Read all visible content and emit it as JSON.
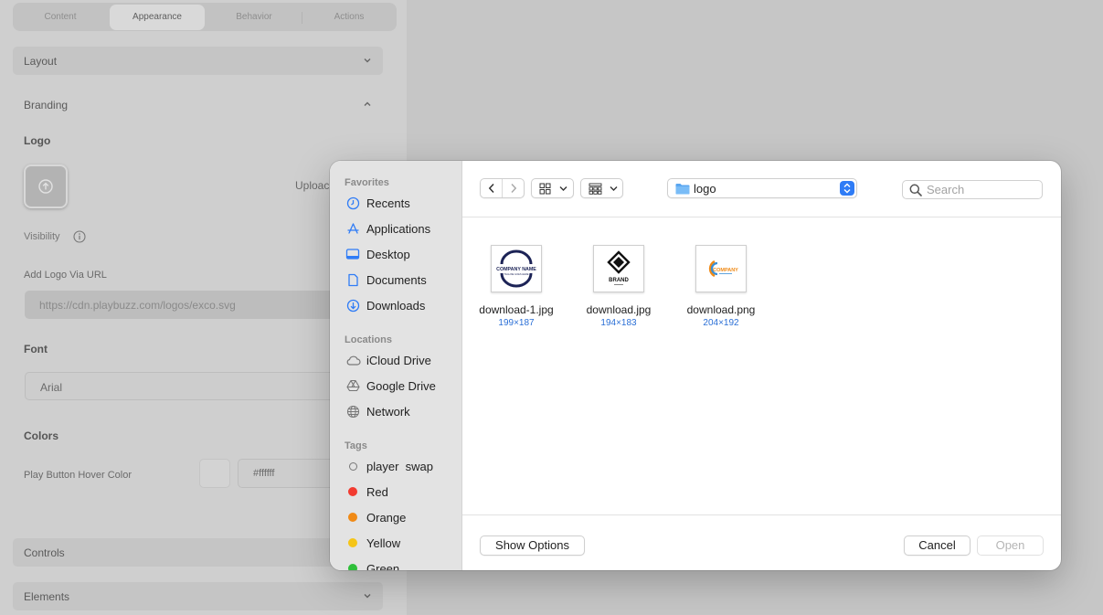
{
  "settings": {
    "tabs": [
      "Content",
      "Appearance",
      "Behavior",
      "Actions"
    ],
    "sections": {
      "layout": "Layout",
      "branding": "Branding",
      "controls": "Controls",
      "elements": "Elements"
    },
    "logo_label": "Logo",
    "upload_label": "Uploac",
    "visibility_label": "Visibility",
    "url_label": "Add Logo Via URL",
    "url_placeholder": "https://cdn.playbuzz.com/logos/exco.svg",
    "font_label": "Font",
    "font_value": "Arial",
    "colors_label": "Colors",
    "hover_color_label": "Play Button Hover Color",
    "hover_color_value": "#ffffff"
  },
  "dialog": {
    "sidebar": {
      "favorites_heading": "Favorites",
      "favorites": [
        {
          "label": "Recents",
          "icon": "clock-icon"
        },
        {
          "label": "Applications",
          "icon": "applications-icon"
        },
        {
          "label": "Desktop",
          "icon": "desktop-icon"
        },
        {
          "label": "Documents",
          "icon": "document-icon"
        },
        {
          "label": "Downloads",
          "icon": "download-icon"
        }
      ],
      "locations_heading": "Locations",
      "locations": [
        {
          "label": "iCloud Drive",
          "icon": "cloud-icon"
        },
        {
          "label": "Google Drive",
          "icon": "google-drive-icon"
        },
        {
          "label": "Network",
          "icon": "globe-icon"
        }
      ],
      "tags_heading": "Tags",
      "tags": [
        {
          "label": "player  swap",
          "color": ""
        },
        {
          "label": "Red",
          "color": "#f23b30"
        },
        {
          "label": "Orange",
          "color": "#f08a16"
        },
        {
          "label": "Yellow",
          "color": "#f5c518"
        },
        {
          "label": "Green",
          "color": "#2fbf3a"
        }
      ]
    },
    "current_folder": "logo",
    "search_placeholder": "Search",
    "files": [
      {
        "name": "download-1.jpg",
        "dims": "199×187"
      },
      {
        "name": "download.jpg",
        "dims": "194×183"
      },
      {
        "name": "download.png",
        "dims": "204×192"
      }
    ],
    "thumb_text": {
      "company_name": "COMPANY NAME",
      "tagline": "TAGLINE GOES HERE",
      "brand": "BRAND",
      "company": "COMPANY"
    },
    "show_options_label": "Show Options",
    "cancel_label": "Cancel",
    "open_label": "Open",
    "accent_color": "#2f7cf6"
  }
}
